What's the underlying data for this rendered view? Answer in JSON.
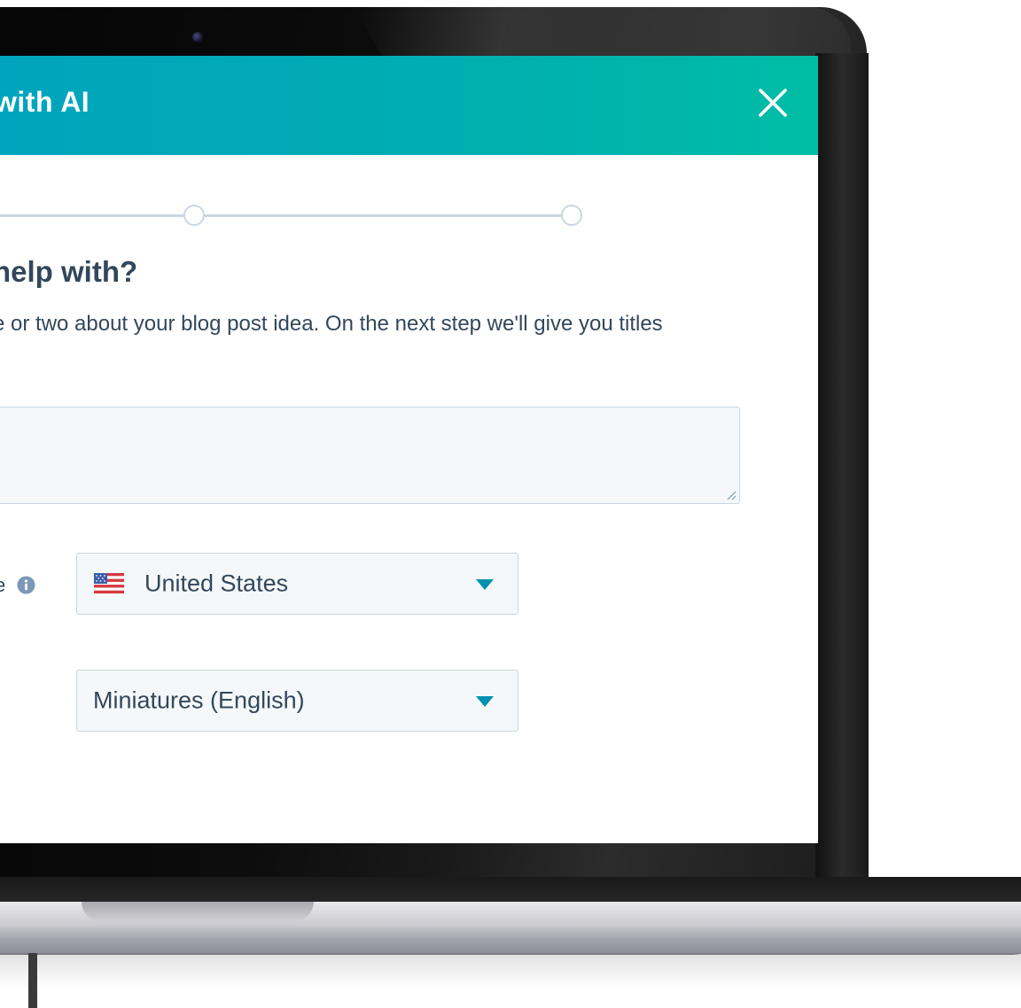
{
  "dialog": {
    "title": "with AI",
    "close_icon": "close-icon",
    "header_gradient": [
      "#00a4bd",
      "#00bda5"
    ]
  },
  "stepper": {
    "steps": 3
  },
  "question": {
    "title": "help with?",
    "help_text": "e or two about your blog post idea. On the next step we'll give you titles"
  },
  "idea_input": {
    "value": ""
  },
  "region_field": {
    "label_tail": "e",
    "info_icon": "info-icon",
    "flag_icon": "us-flag-icon",
    "selected": "United States"
  },
  "language_field": {
    "selected": "Miniatures (English)"
  },
  "colors": {
    "text": "#33475b",
    "accent": "#00a4bd",
    "field_bg": "#f5f8fa",
    "border": "#cbd6e2"
  }
}
